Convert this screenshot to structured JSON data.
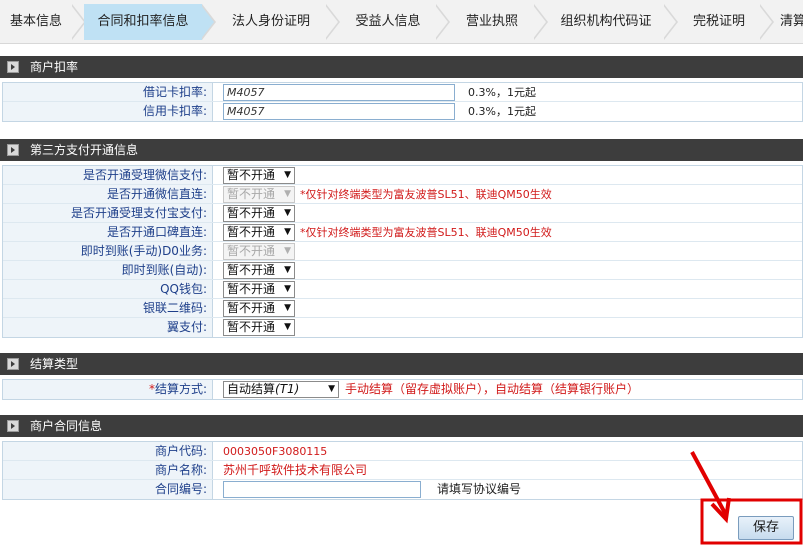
{
  "tabs": [
    {
      "label": "基本信息",
      "active": false
    },
    {
      "label": "合同和扣率信息",
      "active": true
    },
    {
      "label": "法人身份证明",
      "active": false
    },
    {
      "label": "受益人信息",
      "active": false
    },
    {
      "label": "营业执照",
      "active": false
    },
    {
      "label": "组织机构代码证",
      "active": false
    },
    {
      "label": "完税证明",
      "active": false
    },
    {
      "label": "清算",
      "active": false
    }
  ],
  "sections": {
    "rate": {
      "title": "商户扣率",
      "rows": [
        {
          "label": "借记卡扣率:",
          "value": "M4057",
          "note": "0.3%，1元起"
        },
        {
          "label": "信用卡扣率:",
          "value": "M4057",
          "note": "0.3%，1元起"
        }
      ]
    },
    "third_party": {
      "title": "第三方支付开通信息",
      "rows": [
        {
          "label": "是否开通受理微信支付:",
          "value": "暂不开通",
          "disabled": false,
          "note": ""
        },
        {
          "label": "是否开通微信直连:",
          "value": "暂不开通",
          "disabled": true,
          "note": "*仅针对终端类型为富友波普SL51、联迪QM50生效"
        },
        {
          "label": "是否开通受理支付宝支付:",
          "value": "暂不开通",
          "disabled": false,
          "note": ""
        },
        {
          "label": "是否开通口碑直连:",
          "value": "暂不开通",
          "disabled": false,
          "note": "*仅针对终端类型为富友波普SL51、联迪QM50生效"
        },
        {
          "label": "即时到账(手动)D0业务:",
          "value": "暂不开通",
          "disabled": true,
          "note": ""
        },
        {
          "label": "即时到账(自动):",
          "value": "暂不开通",
          "disabled": false,
          "note": ""
        },
        {
          "label": "QQ钱包:",
          "value": "暂不开通",
          "disabled": false,
          "note": ""
        },
        {
          "label": "银联二维码:",
          "value": "暂不开通",
          "disabled": false,
          "note": ""
        },
        {
          "label": "翼支付:",
          "value": "暂不开通",
          "disabled": false,
          "note": ""
        }
      ]
    },
    "settlement": {
      "title": "结算类型",
      "label": "结算方式:",
      "required_mark": "*",
      "value": "自动结算",
      "value_suffix": "(T1)",
      "note": "手动结算（留存虚拟账户），自动结算（结算银行账户）"
    },
    "contract": {
      "title": "商户合同信息",
      "merchant_code_label": "商户代码:",
      "merchant_code": "0003050F3080115",
      "merchant_name_label": "商户名称:",
      "merchant_name": "苏州千呼软件技术有限公司",
      "contract_no_label": "合同编号:",
      "contract_no_value": "",
      "contract_no_hint": "请填写协议编号"
    }
  },
  "save_label": "保存",
  "colors": {
    "active_tab": "#bfe1f4",
    "section_header": "#3d3d3d",
    "label_text": "#1e3f8a",
    "red_text": "#d11a1a"
  }
}
